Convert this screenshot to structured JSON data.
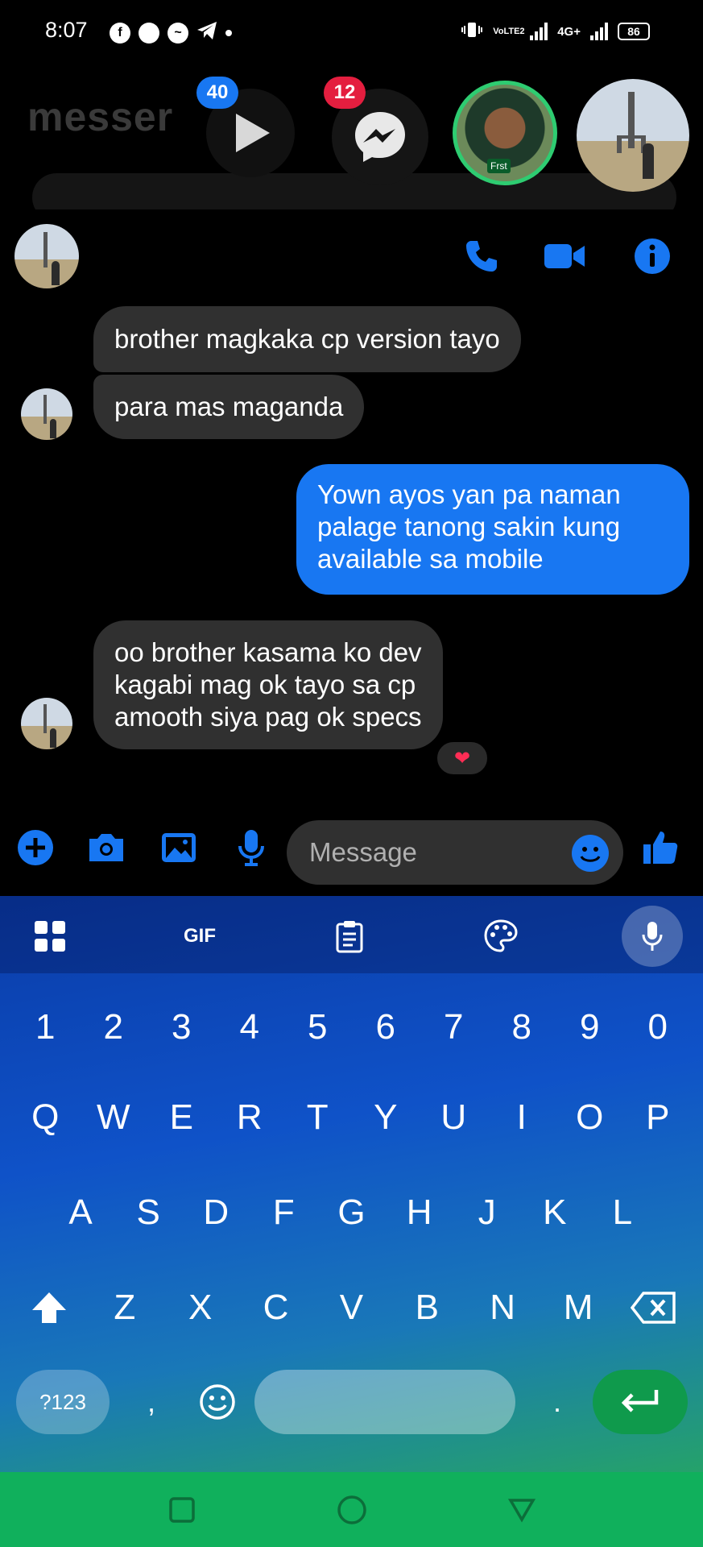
{
  "status_bar": {
    "time": "8:07",
    "network_label": "4G+",
    "volte_label": "VoLTE2",
    "battery": "86",
    "icons": [
      "facebook-icon",
      "chat-icon",
      "messenger-icon",
      "telegram-icon",
      "dot-icon",
      "vibrate-icon",
      "signal-icon",
      "signal-icon",
      "battery-icon"
    ]
  },
  "background": {
    "app_title": "messer"
  },
  "chat_heads": {
    "play_badge": "40",
    "messenger_badge": "12",
    "profile_tag": "Frst"
  },
  "chat_header": {
    "actions": [
      "phone-icon",
      "video-icon",
      "info-icon"
    ]
  },
  "messages": [
    {
      "direction": "incoming",
      "text": "brother magkaka cp version tayo"
    },
    {
      "direction": "incoming",
      "text": "para mas maganda"
    },
    {
      "direction": "outgoing",
      "text": "Yown ayos yan pa naman\npalage tanong sakin kung\navailable sa mobile"
    },
    {
      "direction": "incoming",
      "text": "oo brother kasama ko dev\nkagabi mag ok tayo sa cp\namooth siya pag ok specs",
      "reaction": "❤"
    }
  ],
  "composer": {
    "placeholder": "Message",
    "icons": [
      "plus-icon",
      "camera-icon",
      "gallery-icon",
      "mic-icon",
      "emoji-icon",
      "like-icon"
    ]
  },
  "keyboard": {
    "toolbar": {
      "gif_label": "GIF"
    },
    "number_row": [
      "1",
      "2",
      "3",
      "4",
      "5",
      "6",
      "7",
      "8",
      "9",
      "0"
    ],
    "row_q": [
      "Q",
      "W",
      "E",
      "R",
      "T",
      "Y",
      "U",
      "I",
      "O",
      "P"
    ],
    "row_a": [
      "A",
      "S",
      "D",
      "F",
      "G",
      "H",
      "J",
      "K",
      "L"
    ],
    "row_z": [
      "Z",
      "X",
      "C",
      "V",
      "B",
      "N",
      "M"
    ],
    "symbols_label": "?123",
    "comma": ",",
    "period": "."
  },
  "colors": {
    "accent": "#1877f2",
    "incoming_bubble": "#303030",
    "badge_red": "#e41e3f",
    "nav_green": "#10b05c"
  }
}
